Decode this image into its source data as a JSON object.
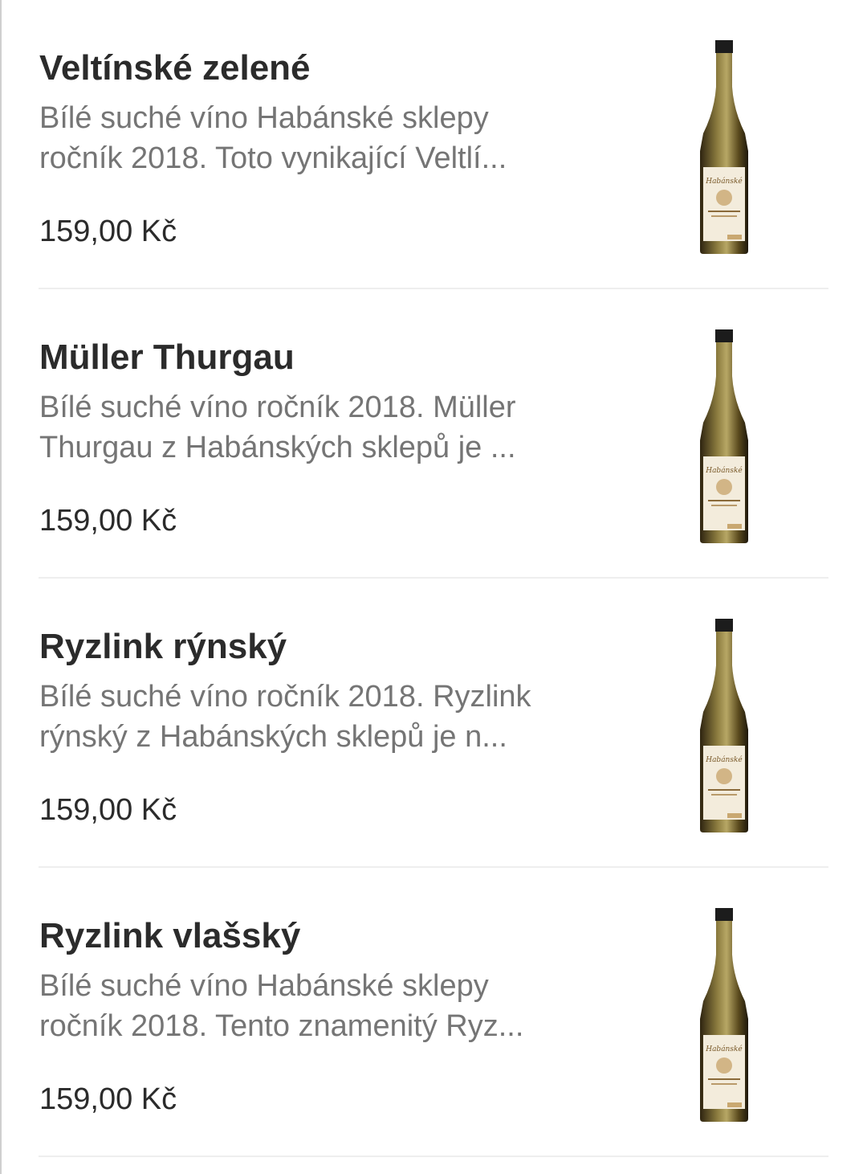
{
  "products": [
    {
      "title": "Veltínské zelené",
      "desc_line1": "Bílé suché víno Habánské sklepy",
      "desc_line2": "ročník 2018. Toto vynikající Veltlí...",
      "price": "159,00 Kč",
      "image_icon": "wine-bottle-icon",
      "label_text": "Habánské"
    },
    {
      "title": "Müller Thurgau",
      "desc_line1": "Bílé suché víno ročník 2018. Müller",
      "desc_line2": "Thurgau z Habánských sklepů je ...",
      "price": "159,00 Kč",
      "image_icon": "wine-bottle-icon",
      "label_text": "Habánské"
    },
    {
      "title": "Ryzlink rýnský",
      "desc_line1": "Bílé suché víno ročník 2018. Ryzlink",
      "desc_line2": "rýnský z Habánských sklepů je n...",
      "price": "159,00 Kč",
      "image_icon": "wine-bottle-icon",
      "label_text": "Habánské"
    },
    {
      "title": "Ryzlink vlašský",
      "desc_line1": "Bílé suché víno Habánské sklepy",
      "desc_line2": "ročník 2018. Tento znamenitý Ryz...",
      "price": "159,00 Kč",
      "image_icon": "wine-bottle-icon",
      "label_text": "Habánské"
    }
  ],
  "colors": {
    "title": "#2b2b2b",
    "description": "#757575",
    "price": "#2b2b2b",
    "divider": "#eeeeee",
    "bottle_glass": "#5a4a1e",
    "bottle_label": "#f3ecdc"
  }
}
